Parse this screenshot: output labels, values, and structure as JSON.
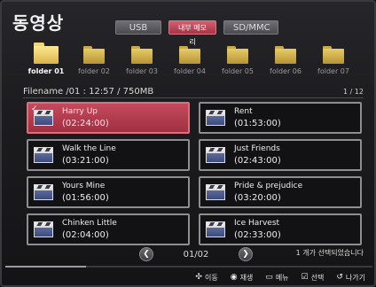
{
  "header": {
    "title": "동영상",
    "sources": [
      {
        "label": "USB",
        "active": false
      },
      {
        "label": "내부 메모리",
        "active": true
      },
      {
        "label": "SD/MMC",
        "active": false
      }
    ]
  },
  "folders": [
    {
      "label": "folder 01",
      "selected": true
    },
    {
      "label": "folder 02",
      "selected": false
    },
    {
      "label": "folder 03",
      "selected": false
    },
    {
      "label": "folder 04",
      "selected": false
    },
    {
      "label": "folder 05",
      "selected": false
    },
    {
      "label": "folder 06",
      "selected": false
    },
    {
      "label": "folder 07",
      "selected": false
    }
  ],
  "info": {
    "path": "Filename /01 : 12:57 / 750MB",
    "page": "1 / 12"
  },
  "items": [
    {
      "name": "Harry Up",
      "duration": "(02:24:00)",
      "focused": true,
      "checked": true
    },
    {
      "name": "Rent",
      "duration": "(01:53:00)",
      "focused": false,
      "checked": false
    },
    {
      "name": "Walk the  Line",
      "duration": "(03:21:00)",
      "focused": false,
      "checked": false
    },
    {
      "name": "Just Friends",
      "duration": "(02:43:00)",
      "focused": false,
      "checked": false
    },
    {
      "name": "Yours Mine",
      "duration": "(01:56:00)",
      "focused": false,
      "checked": false
    },
    {
      "name": "Pride & prejudice",
      "duration": "(03:20:00)",
      "focused": false,
      "checked": false
    },
    {
      "name": "Chinken Little",
      "duration": "(02:04:00)",
      "focused": false,
      "checked": false
    },
    {
      "name": "Ice Harvest",
      "duration": "(02:33:00)",
      "focused": false,
      "checked": false
    }
  ],
  "pager": {
    "prev_icon": "chevron-left-icon",
    "next_icon": "chevron-right-icon",
    "page": "01/02"
  },
  "selection_status": "1 개가 선택되었습니다",
  "progress_fraction": 0.22,
  "hints": [
    {
      "icon": "move-arrows-icon",
      "glyph": "✣",
      "label": "이동"
    },
    {
      "icon": "play-dot-icon",
      "glyph": "◉",
      "label": "재생"
    },
    {
      "icon": "menu-screen-icon",
      "glyph": "▭",
      "label": "메뉴"
    },
    {
      "icon": "checkbox-icon",
      "glyph": "☑",
      "label": "선택"
    },
    {
      "icon": "back-arrow-icon",
      "glyph": "↺",
      "label": "나가기"
    }
  ],
  "colors": {
    "accent": "#b23a4e",
    "frame": "#8e8e92",
    "folder": "#d9b448"
  }
}
